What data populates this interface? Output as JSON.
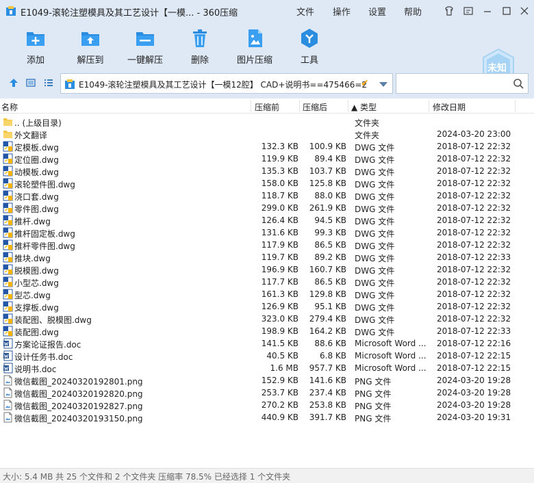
{
  "title": "E1049-滚轮注塑模具及其工艺设计【一模... - 360压缩",
  "menu": [
    "文件",
    "操作",
    "设置",
    "帮助"
  ],
  "toolbar": [
    {
      "label": "添加",
      "icon": "add-icon"
    },
    {
      "label": "解压到",
      "icon": "extract-to-icon"
    },
    {
      "label": "一键解压",
      "icon": "one-click-extract-icon"
    },
    {
      "label": "删除",
      "icon": "delete-icon"
    },
    {
      "label": "图片压缩",
      "icon": "image-compress-icon"
    },
    {
      "label": "工具",
      "icon": "tools-icon"
    }
  ],
  "badge": {
    "label": "未知"
  },
  "address": {
    "path": "E1049-滚轮注塑模具及其工艺设计【一模12腔】 CAD+说明书==475466=25"
  },
  "search": {
    "placeholder": ""
  },
  "columns": {
    "name": "名称",
    "packed": "压缩前",
    "unpacked": "压缩后",
    "type": "▲ 类型",
    "modified": "修改日期"
  },
  "files": [
    {
      "name": ".. (上级目录)",
      "size": "",
      "packed": "",
      "type": "文件夹",
      "date": "",
      "kind": "folder"
    },
    {
      "name": "外文翻译",
      "size": "",
      "packed": "",
      "type": "文件夹",
      "date": "2024-03-20 23:00",
      "kind": "folder"
    },
    {
      "name": "定模板.dwg",
      "size": "132.3 KB",
      "packed": "100.9 KB",
      "type": "DWG 文件",
      "date": "2018-07-12 22:32",
      "kind": "dwg"
    },
    {
      "name": "定位圈.dwg",
      "size": "119.9 KB",
      "packed": "89.4 KB",
      "type": "DWG 文件",
      "date": "2018-07-12 22:32",
      "kind": "dwg"
    },
    {
      "name": "动模板.dwg",
      "size": "135.3 KB",
      "packed": "103.7 KB",
      "type": "DWG 文件",
      "date": "2018-07-12 22:32",
      "kind": "dwg"
    },
    {
      "name": "滚轮塑件图.dwg",
      "size": "158.0 KB",
      "packed": "125.8 KB",
      "type": "DWG 文件",
      "date": "2018-07-12 22:32",
      "kind": "dwg"
    },
    {
      "name": "浇口套.dwg",
      "size": "118.7 KB",
      "packed": "88.0 KB",
      "type": "DWG 文件",
      "date": "2018-07-12 22:32",
      "kind": "dwg"
    },
    {
      "name": "零件图.dwg",
      "size": "299.0 KB",
      "packed": "261.9 KB",
      "type": "DWG 文件",
      "date": "2018-07-12 22:32",
      "kind": "dwg"
    },
    {
      "name": "推杆.dwg",
      "size": "126.4 KB",
      "packed": "94.5 KB",
      "type": "DWG 文件",
      "date": "2018-07-12 22:32",
      "kind": "dwg"
    },
    {
      "name": "推杆固定板.dwg",
      "size": "131.6 KB",
      "packed": "99.3 KB",
      "type": "DWG 文件",
      "date": "2018-07-12 22:32",
      "kind": "dwg"
    },
    {
      "name": "推杆零件图.dwg",
      "size": "117.9 KB",
      "packed": "86.5 KB",
      "type": "DWG 文件",
      "date": "2018-07-12 22:32",
      "kind": "dwg"
    },
    {
      "name": "推块.dwg",
      "size": "119.7 KB",
      "packed": "89.2 KB",
      "type": "DWG 文件",
      "date": "2018-07-12 22:33",
      "kind": "dwg"
    },
    {
      "name": "脱模图.dwg",
      "size": "196.9 KB",
      "packed": "160.7 KB",
      "type": "DWG 文件",
      "date": "2018-07-12 22:32",
      "kind": "dwg"
    },
    {
      "name": "小型芯.dwg",
      "size": "117.7 KB",
      "packed": "86.5 KB",
      "type": "DWG 文件",
      "date": "2018-07-12 22:32",
      "kind": "dwg"
    },
    {
      "name": "型芯.dwg",
      "size": "161.3 KB",
      "packed": "129.8 KB",
      "type": "DWG 文件",
      "date": "2018-07-12 22:32",
      "kind": "dwg"
    },
    {
      "name": "支撑板.dwg",
      "size": "126.9 KB",
      "packed": "95.1 KB",
      "type": "DWG 文件",
      "date": "2018-07-12 22:32",
      "kind": "dwg"
    },
    {
      "name": "装配图、脱模图.dwg",
      "size": "323.0 KB",
      "packed": "279.4 KB",
      "type": "DWG 文件",
      "date": "2018-07-12 22:32",
      "kind": "dwg"
    },
    {
      "name": "装配图.dwg",
      "size": "198.9 KB",
      "packed": "164.2 KB",
      "type": "DWG 文件",
      "date": "2018-07-12 22:33",
      "kind": "dwg"
    },
    {
      "name": "方案论证报告.doc",
      "size": "141.5 KB",
      "packed": "88.6 KB",
      "type": "Microsoft Word ...",
      "date": "2018-07-12 22:16",
      "kind": "doc"
    },
    {
      "name": "设计任务书.doc",
      "size": "40.5 KB",
      "packed": "6.8 KB",
      "type": "Microsoft Word ...",
      "date": "2018-07-12 22:15",
      "kind": "doc"
    },
    {
      "name": "说明书.doc",
      "size": "1.6 MB",
      "packed": "957.7 KB",
      "type": "Microsoft Word ...",
      "date": "2018-07-12 22:15",
      "kind": "doc"
    },
    {
      "name": "微信截图_20240320192801.png",
      "size": "152.9 KB",
      "packed": "141.6 KB",
      "type": "PNG 文件",
      "date": "2024-03-20 19:28",
      "kind": "png"
    },
    {
      "name": "微信截图_20240320192820.png",
      "size": "253.7 KB",
      "packed": "237.4 KB",
      "type": "PNG 文件",
      "date": "2024-03-20 19:28",
      "kind": "png"
    },
    {
      "name": "微信截图_20240320192827.png",
      "size": "270.2 KB",
      "packed": "253.8 KB",
      "type": "PNG 文件",
      "date": "2024-03-20 19:28",
      "kind": "png"
    },
    {
      "name": "微信截图_20240320193150.png",
      "size": "440.9 KB",
      "packed": "391.7 KB",
      "type": "PNG 文件",
      "date": "2024-03-20 19:31",
      "kind": "png"
    }
  ],
  "status": "大小: 5.4 MB 共 25 个文件和 2 个文件夹 压缩率 78.5% 已经选择 1 个文件夹",
  "colors": {
    "accent": "#2a8de0",
    "chrome": "#dfe9f5",
    "folder": "#f5c542",
    "dwg_blue": "#2456a8",
    "badge": "#bfe0f7"
  }
}
